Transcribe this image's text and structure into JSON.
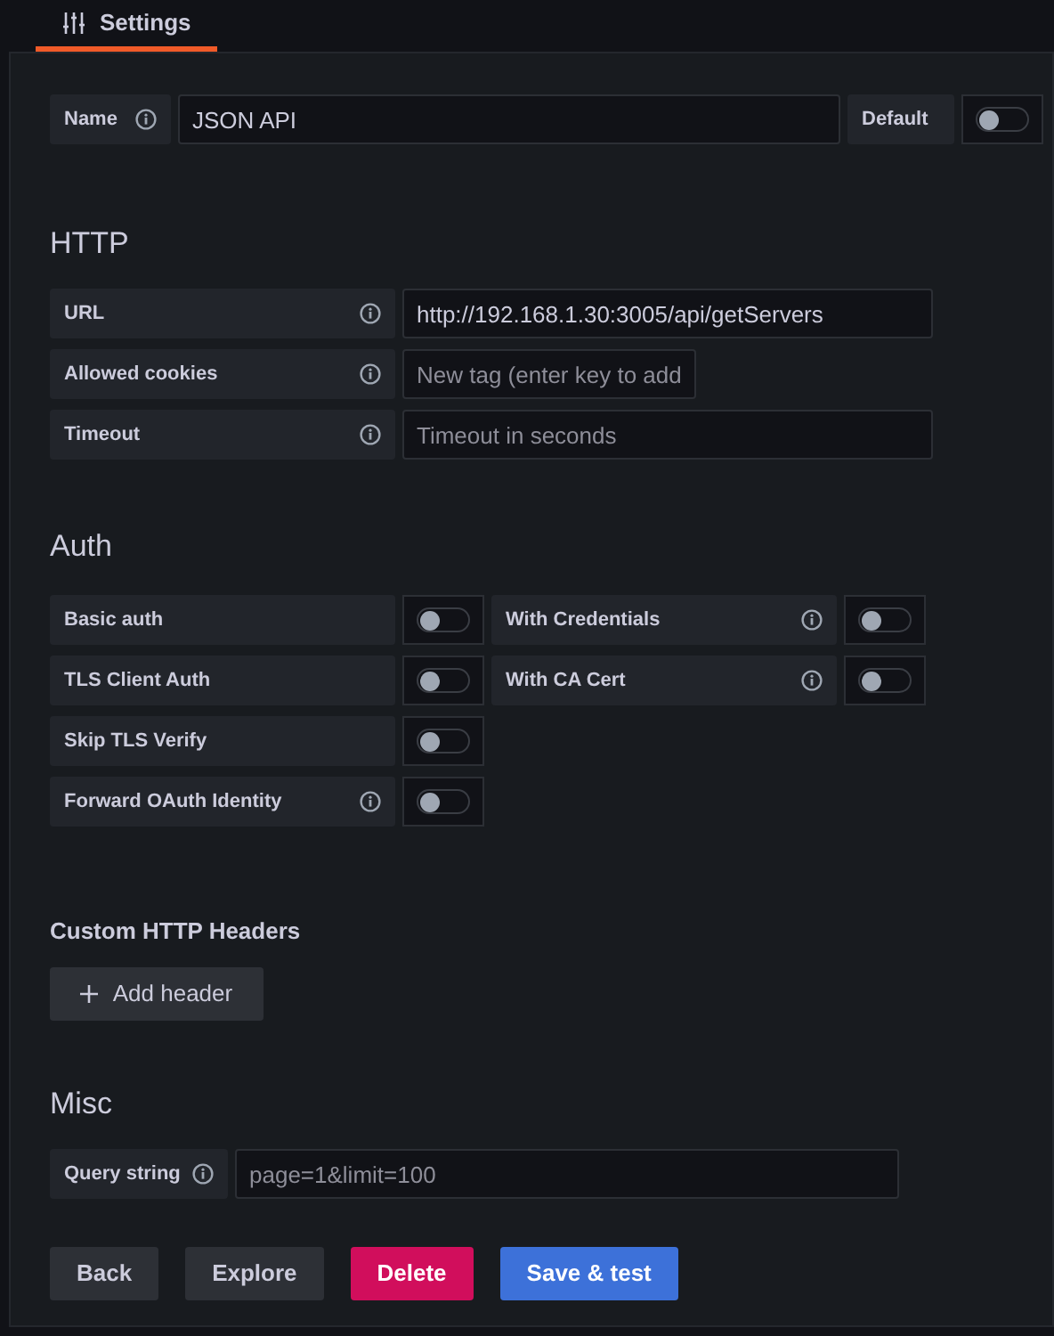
{
  "tabs": [
    {
      "label": "Settings",
      "selected": true
    }
  ],
  "name_row": {
    "label": "Name",
    "info": true,
    "value": "JSON API",
    "default_label": "Default",
    "default_on": false
  },
  "http": {
    "title": "HTTP",
    "fields": [
      {
        "label": "URL",
        "info": true,
        "value": "http://192.168.1.30:3005/api/getServers",
        "wide": true
      },
      {
        "label": "Allowed cookies",
        "info": true,
        "placeholder": "New tag (enter key to add",
        "wide": false
      },
      {
        "label": "Timeout",
        "info": true,
        "placeholder": "Timeout in seconds",
        "wide": true
      }
    ]
  },
  "auth": {
    "title": "Auth",
    "rows": [
      [
        {
          "label": "Basic auth",
          "info": false,
          "on": false
        },
        {
          "label": "With Credentials",
          "info": true,
          "on": false
        }
      ],
      [
        {
          "label": "TLS Client Auth",
          "info": false,
          "on": false
        },
        {
          "label": "With CA Cert",
          "info": true,
          "on": false
        }
      ],
      [
        {
          "label": "Skip TLS Verify",
          "info": false,
          "on": false
        }
      ],
      [
        {
          "label": "Forward OAuth Identity",
          "info": true,
          "on": false
        }
      ]
    ]
  },
  "headers": {
    "title": "Custom HTTP Headers",
    "add_button": "Add header"
  },
  "misc": {
    "title": "Misc",
    "field": {
      "label": "Query string",
      "info": true,
      "placeholder": "page=1&limit=100"
    }
  },
  "buttons": [
    {
      "label": "Back",
      "kind": "secondary"
    },
    {
      "label": "Explore",
      "kind": "secondary"
    },
    {
      "label": "Delete",
      "kind": "danger"
    },
    {
      "label": "Save & test",
      "kind": "primary"
    }
  ]
}
